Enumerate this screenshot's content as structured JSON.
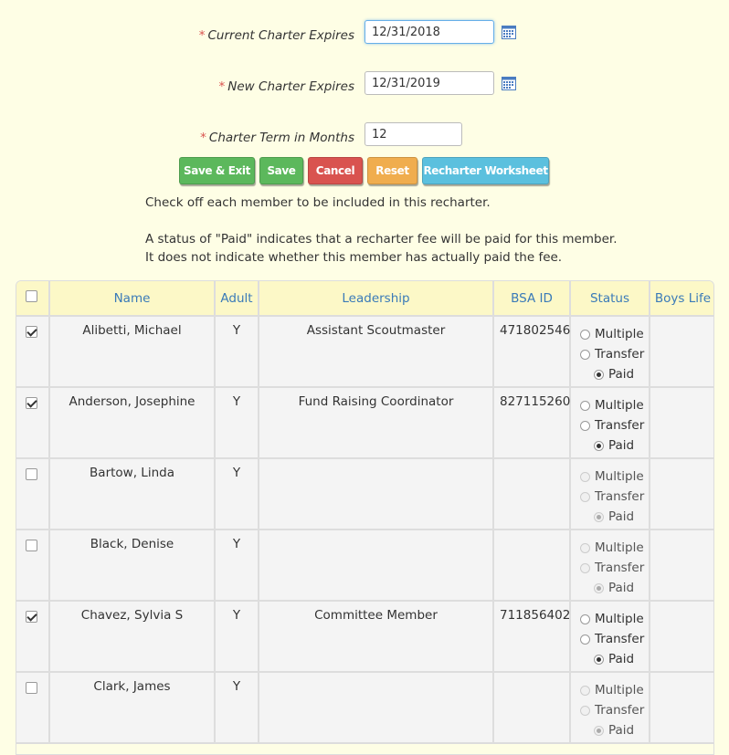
{
  "form": {
    "current_expires": {
      "label": "Current Charter Expires",
      "value": "12/31/2018"
    },
    "new_expires": {
      "label": "New Charter Expires",
      "value": "12/31/2019"
    },
    "term": {
      "label": "Charter Term in Months",
      "value": "12"
    },
    "required_mark": "*"
  },
  "buttons": {
    "save_exit": "Save & Exit",
    "save": "Save",
    "cancel": "Cancel",
    "reset": "Reset",
    "worksheet": "Recharter Worksheet"
  },
  "info": {
    "line1": "Check off each member to be included in this recharter.",
    "line2": "A status of \"Paid\" indicates that a recharter fee will be paid for this member.",
    "line3": "It does not indicate whether this member has actually paid the fee."
  },
  "table": {
    "headers": {
      "name": "Name",
      "adult": "Adult",
      "leadership": "Leadership",
      "bsa_id": "BSA ID",
      "status": "Status",
      "boys_life": "Boys Life"
    },
    "status_options": {
      "multiple": "Multiple",
      "transfer": "Transfer",
      "paid": "Paid"
    },
    "rows": [
      {
        "checked": true,
        "name": "Alibetti, Michael",
        "adult": "Y",
        "leadership": "Assistant Scoutmaster",
        "bsa_id": "471802546",
        "status": "Paid",
        "enabled": true
      },
      {
        "checked": true,
        "name": "Anderson, Josephine",
        "adult": "Y",
        "leadership": "Fund Raising Coordinator",
        "bsa_id": "827115260",
        "status": "Paid",
        "enabled": true
      },
      {
        "checked": false,
        "name": "Bartow, Linda",
        "adult": "Y",
        "leadership": "",
        "bsa_id": "",
        "status": "Paid",
        "enabled": false
      },
      {
        "checked": false,
        "name": "Black, Denise",
        "adult": "Y",
        "leadership": "",
        "bsa_id": "",
        "status": "Paid",
        "enabled": false
      },
      {
        "checked": true,
        "name": "Chavez, Sylvia S",
        "adult": "Y",
        "leadership": "Committee Member",
        "bsa_id": "711856402",
        "status": "Paid",
        "enabled": true
      },
      {
        "checked": false,
        "name": "Clark, James",
        "adult": "Y",
        "leadership": "",
        "bsa_id": "",
        "status": "Paid",
        "enabled": false
      }
    ]
  }
}
